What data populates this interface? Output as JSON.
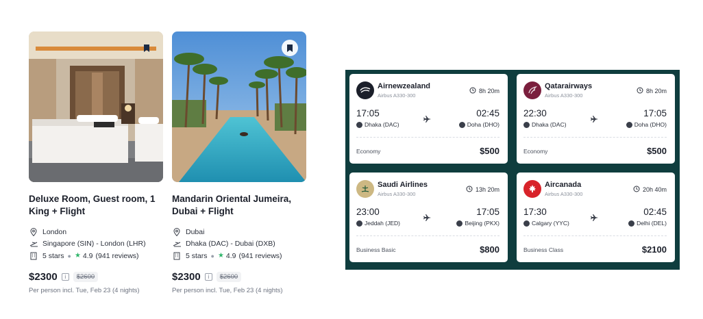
{
  "hotels": [
    {
      "title": "Deluxe Room, Guest room, 1 King + Flight",
      "location": "London",
      "route": "Singapore (SIN) - London (LHR)",
      "stars": "5 stars",
      "rating": "4.9",
      "reviews": "(941 reviews)",
      "price": "$2300",
      "old_price": "$2600",
      "note": "Per person incl. Tue, Feb 23 (4 nights)"
    },
    {
      "title": "Mandarin Oriental Jumeira, Dubai + Flight",
      "location": "Dubai",
      "route": "Dhaka (DAC) - Dubai (DXB)",
      "stars": "5 stars",
      "rating": "4.9",
      "reviews": "(941 reviews)",
      "price": "$2300",
      "old_price": "$2600",
      "note": "Per person incl. Tue, Feb 23 (4 nights)"
    }
  ],
  "flights": [
    {
      "airline": "Airnewzealand",
      "aircraft": "Airbus A330-300",
      "duration": "8h 20m",
      "dep_time": "17:05",
      "arr_time": "02:45",
      "from": "Dhaka (DAC)",
      "to": "Doha (DHO)",
      "cabin": "Economy",
      "price": "$500"
    },
    {
      "airline": "Qatarairways",
      "aircraft": "Airbus A330-300",
      "duration": "8h 20m",
      "dep_time": "22:30",
      "arr_time": "17:05",
      "from": "Dhaka (DAC)",
      "to": "Doha (DHO)",
      "cabin": "Economy",
      "price": "$500"
    },
    {
      "airline": "Saudi Airlines",
      "aircraft": "Airbus A330-300",
      "duration": "13h 20m",
      "dep_time": "23:00",
      "arr_time": "17:05",
      "from": "Jeddah (JED)",
      "to": "Beijing (PKX)",
      "cabin": "Business Basic",
      "price": "$800"
    },
    {
      "airline": "Aircanada",
      "aircraft": "Airbus A330-300",
      "duration": "20h 40m",
      "dep_time": "17:30",
      "arr_time": "02:45",
      "from": "Calgary (YYC)",
      "to": "Delhi (DEL)",
      "cabin": "Business Class",
      "price": "$2100"
    }
  ],
  "colors": {
    "panel_bg": "#0f3d3e",
    "rating_star": "#2fb56a",
    "airnewzealand_logo": "#1b1f2a",
    "qatar_logo": "#7a1f3d",
    "saudi_logo": "#cdb883",
    "aircanada_logo": "#d8232a"
  },
  "icons": {
    "bookmark": "bookmark-icon",
    "location": "map-pin-icon",
    "route": "plane-route-icon",
    "stars": "building-icon",
    "rating": "star-icon",
    "info": "info-icon",
    "duration": "clock-icon",
    "flight": "plane-icon",
    "airport": "location-dot-icon"
  }
}
